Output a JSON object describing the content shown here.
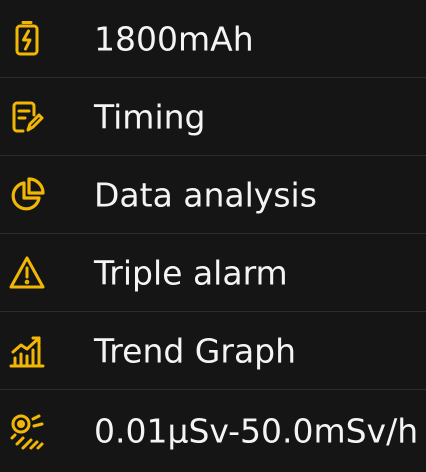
{
  "accent_color": "#f2b705",
  "background_color": "#151515",
  "features": [
    {
      "icon": "battery-icon",
      "label": "1800mAh"
    },
    {
      "icon": "timing-icon",
      "label": "Timing"
    },
    {
      "icon": "pie-chart-icon",
      "label": "Data analysis"
    },
    {
      "icon": "warning-icon",
      "label": "Triple alarm"
    },
    {
      "icon": "trend-graph-icon",
      "label": "Trend Graph"
    },
    {
      "icon": "radiation-sensor-icon",
      "label": "0.01μSv-50.0mSv/h"
    }
  ]
}
